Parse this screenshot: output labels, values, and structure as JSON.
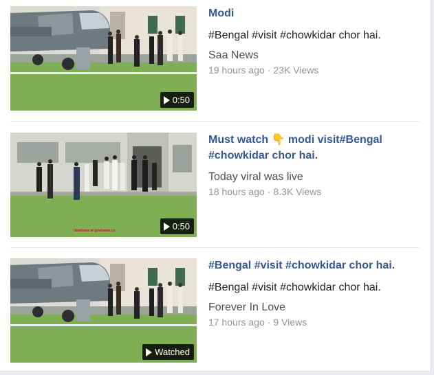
{
  "videos": [
    {
      "title": "Modi",
      "description": "#Bengal #visit #chowkidar chor hai.",
      "page": "Saa News",
      "time": "19 hours ago",
      "views": "23K Views",
      "badge": "0:50",
      "badge_icon": "play-icon"
    },
    {
      "title": "Must watch 👇 modi visit#Bengal #chowkidar chor hai.",
      "description": "",
      "page": "Today viral was live",
      "time": "18 hours ago",
      "views": "8.3K Views",
      "badge": "0:50",
      "badge_icon": "play-icon",
      "watermark": "Uuadrans at govtnews.co"
    },
    {
      "title": "#Bengal #visit #chowkidar chor hai.",
      "description": "#Bengal #visit #chowkidar chor hai.",
      "page": "Forever In Love",
      "time": "17 hours ago",
      "views": "9 Views",
      "badge": "Watched",
      "badge_icon": "play-icon"
    }
  ],
  "separator": "·",
  "colors": {
    "title": "#365899",
    "text": "#1d2129",
    "meta": "#90949c",
    "grass": "#7fae55",
    "badge_bg": "#000000"
  }
}
